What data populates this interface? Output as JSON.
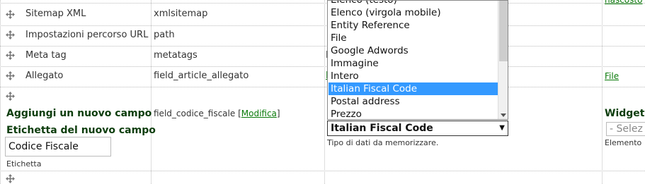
{
  "rows": [
    {
      "label": "Sitemap XML",
      "machine": "xmlsitemap",
      "extra": ""
    },
    {
      "label": "Impostazioni percorso URL",
      "machine": "path",
      "extra": ""
    },
    {
      "label": "Meta tag",
      "machine": "metatags",
      "extra": "I"
    },
    {
      "label": "Allegato",
      "machine": "field_article_allegato",
      "extra": "F",
      "widget_link": "File"
    }
  ],
  "top_right_link": "nascosto",
  "new_field": {
    "heading": "Aggiungi un nuovo campo",
    "label_caption": "Etichetta del nuovo campo",
    "label_value": "Codice Fiscale",
    "label_help": "Etichetta",
    "machine_name": "field_codice_fiscale",
    "edit_link": "Modifica",
    "type_selected": "Italian Fiscal Code",
    "type_help": "Tipo di dati da memorizzare.",
    "widget_heading": "Widget p",
    "widget_placeholder": "- Selez",
    "widget_help": "Elemento"
  },
  "dropdown": {
    "options": [
      "Elenco (testo)",
      "Elenco (virgola mobile)",
      "Entity Reference",
      "File",
      "Google Adwords",
      "Immagine",
      "Intero",
      "Italian Fiscal Code",
      "Postal address",
      "Prezzo"
    ],
    "selected_index": 7
  },
  "colors": {
    "link": "#0a7a0a",
    "heading": "#0c3d0c",
    "highlight": "#3399ff"
  }
}
